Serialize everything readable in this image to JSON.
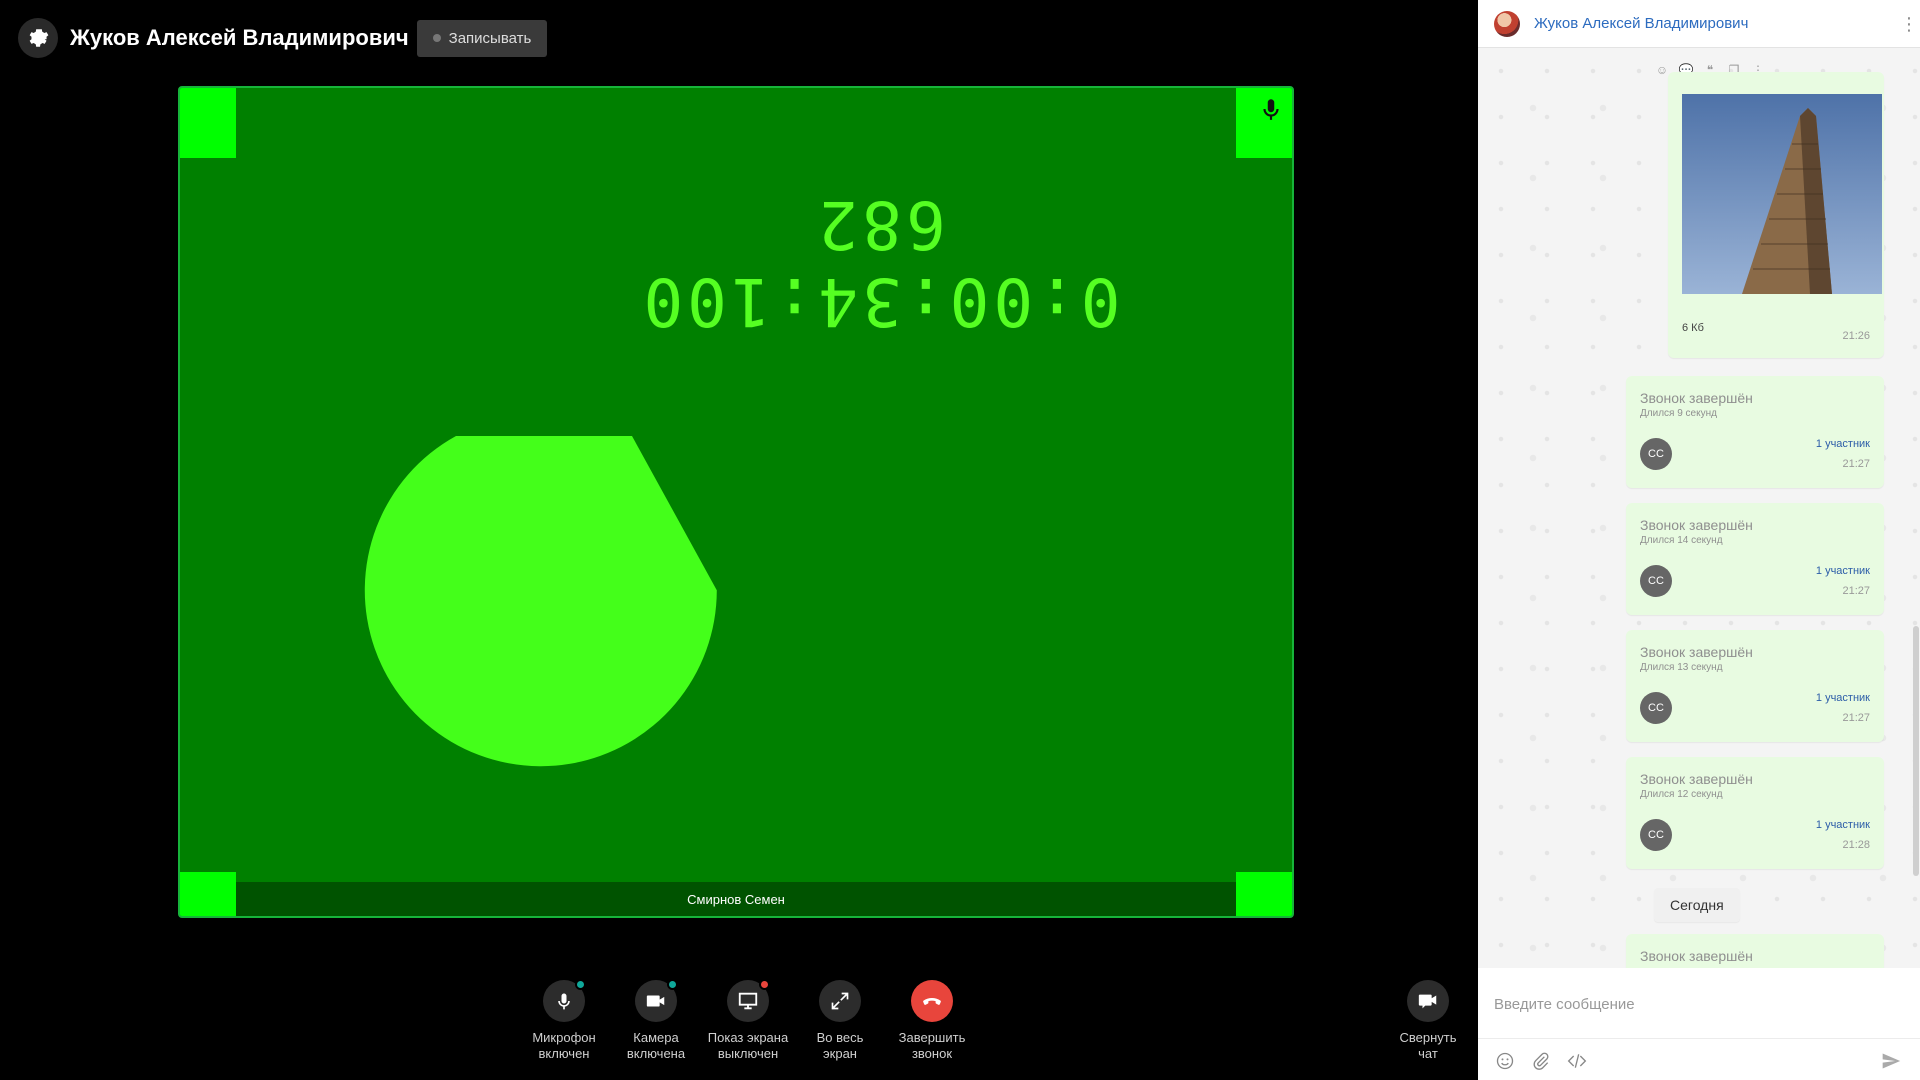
{
  "call": {
    "title": "Жуков Алексей Владимирович",
    "record_label": "Записывать",
    "video": {
      "timestamp": "0:00:34:100 682",
      "participant_name": "Смирнов Семен",
      "pie_fraction": 0.67
    },
    "controls": [
      {
        "icon": "microphone-icon",
        "label": "Микрофон\nвключен",
        "badge_color": "#0fa89a"
      },
      {
        "icon": "camera-icon",
        "label": "Камера\nвключена",
        "badge_color": "#0fa89a"
      },
      {
        "icon": "screen-share-icon",
        "label": "Показ экрана\nвыключен",
        "badge_color": "#e8453c"
      },
      {
        "icon": "fullscreen-icon",
        "label": "Во весь\nэкран"
      },
      {
        "icon": "hang-up-icon",
        "label": "Завершить\nзвонок"
      }
    ],
    "collapse_chat_label": "Свернуть\nчат"
  },
  "chat": {
    "title": "Жуков Алексей Владимирович",
    "image_message": {
      "size": "6 Кб",
      "time": "21:26"
    },
    "call_messages": [
      {
        "title": "Звонок завершён",
        "duration": "Длился 9 секунд",
        "avatar": "СС",
        "participants": "1 участник",
        "time": "21:27"
      },
      {
        "title": "Звонок завершён",
        "duration": "Длился 14 секунд",
        "avatar": "СС",
        "participants": "1 участник",
        "time": "21:27"
      },
      {
        "title": "Звонок завершён",
        "duration": "Длился 13 секунд",
        "avatar": "СС",
        "participants": "1 участник",
        "time": "21:27"
      },
      {
        "title": "Звонок завершён",
        "duration": "Длился 12 секунд",
        "avatar": "СС",
        "participants": "1 участник",
        "time": "21:28"
      }
    ],
    "date_divider": "Сегодня",
    "last_message_title": "Звонок завершён",
    "input_placeholder": "Введите сообщение"
  },
  "colors": {
    "video_bg": "#008000",
    "video_marker": "#00ff00",
    "pie": "#44ff1a",
    "hang_up": "#e8453c",
    "bubble": "#e8fbe1",
    "link": "#2c6bbf"
  }
}
